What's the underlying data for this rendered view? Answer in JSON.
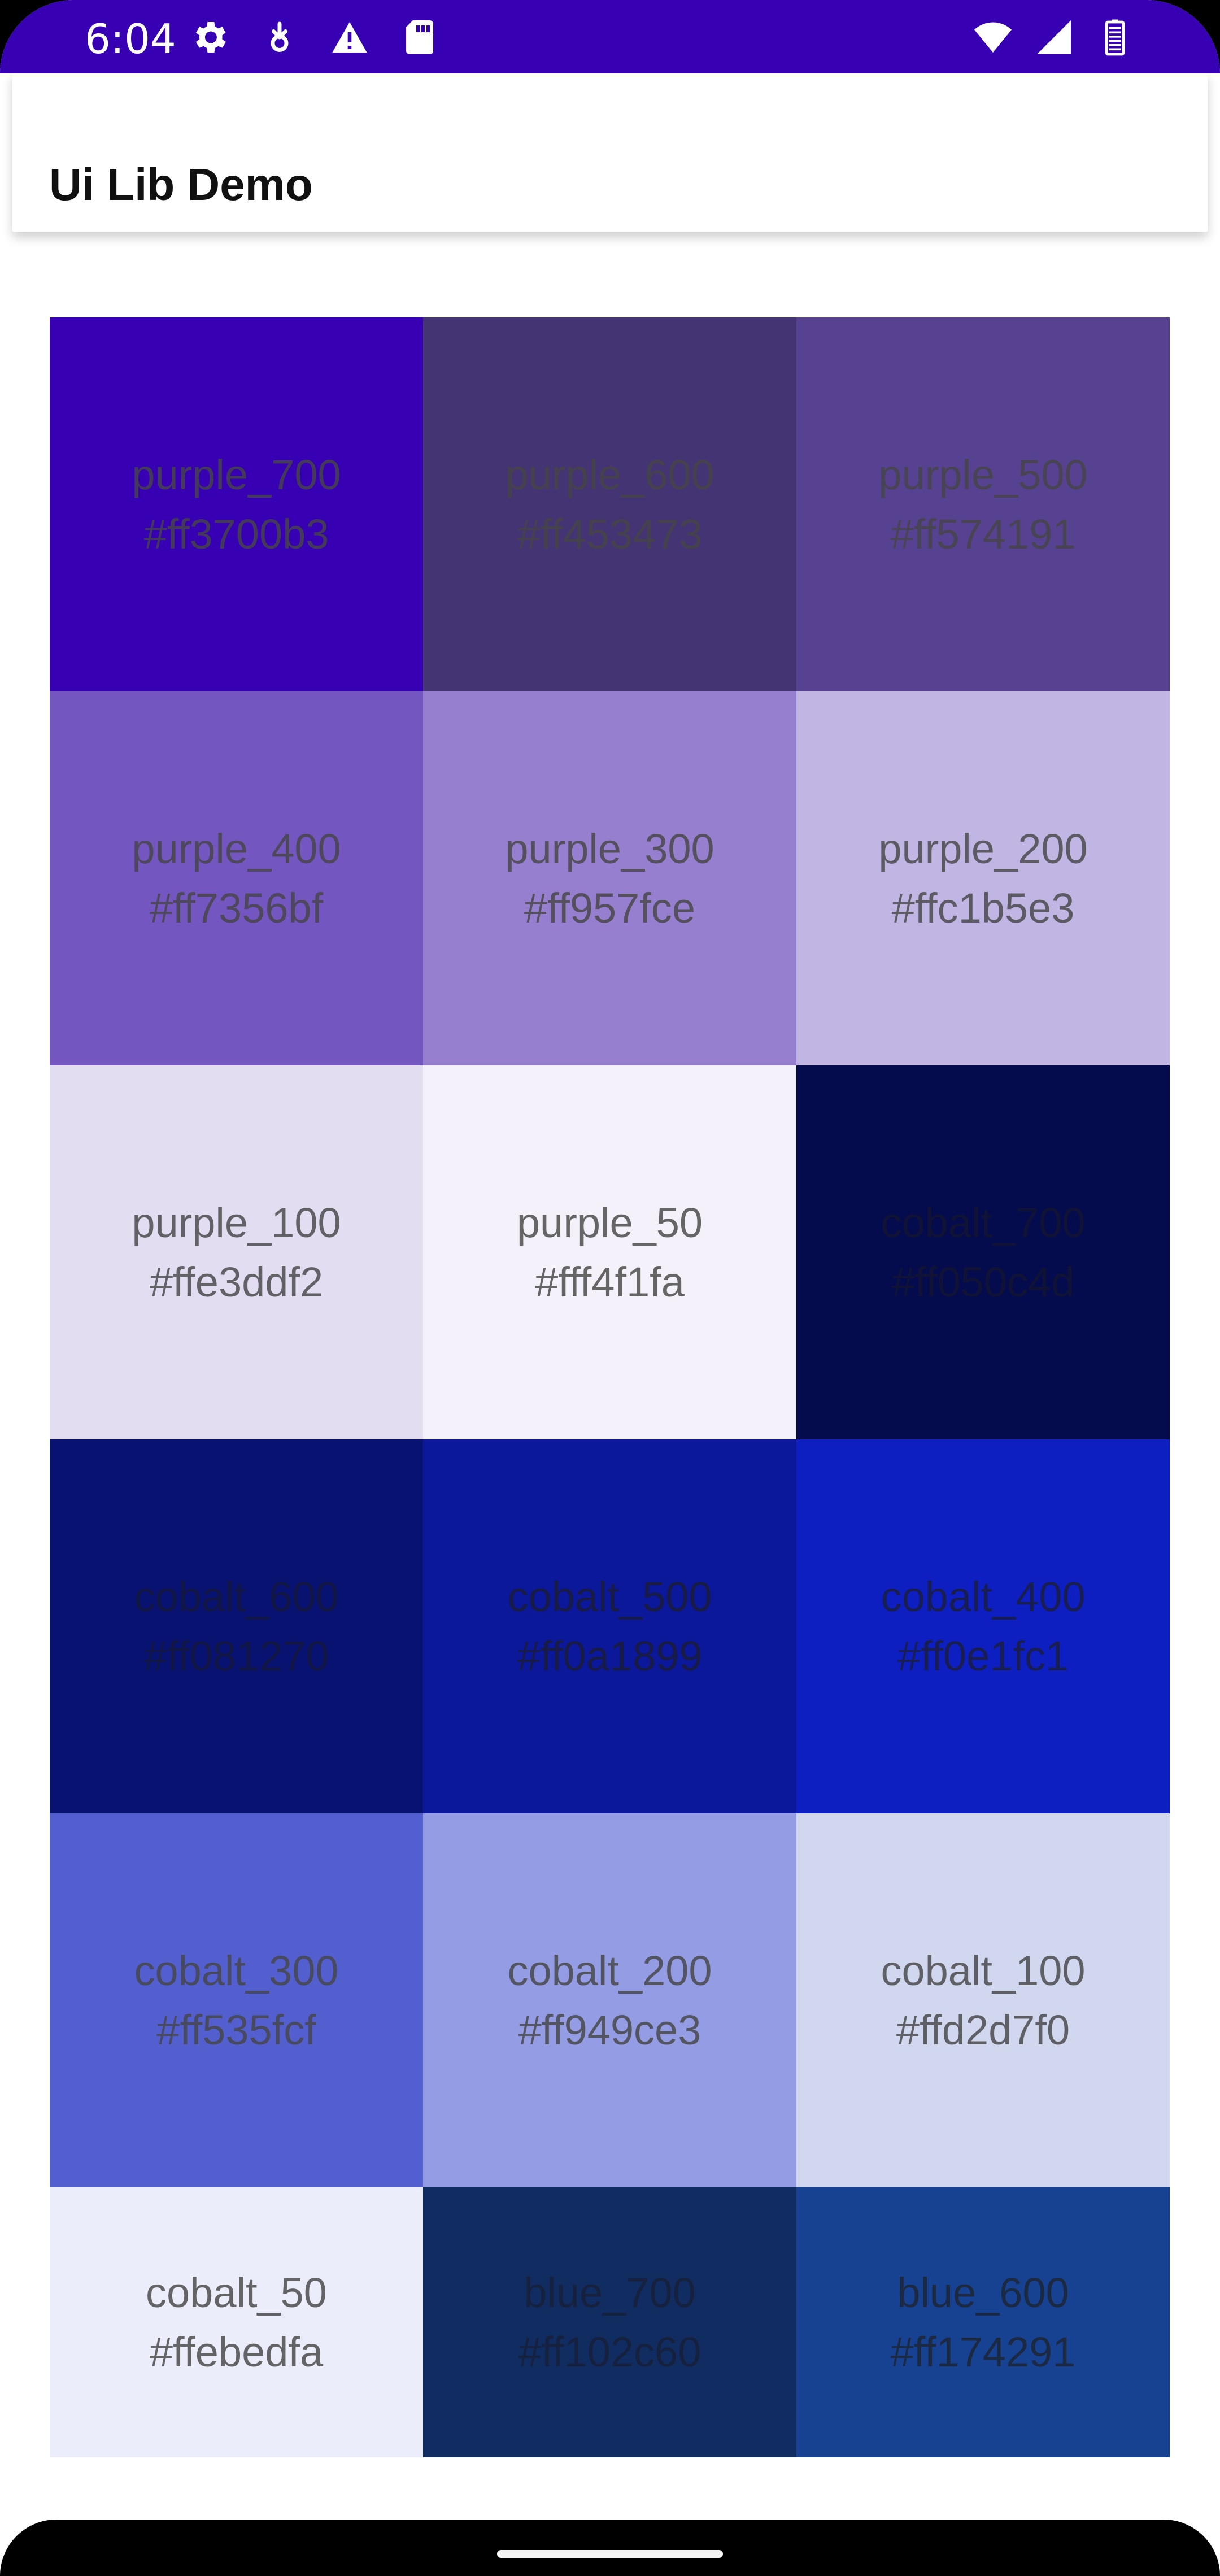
{
  "status_bar": {
    "time": "6:04",
    "left_icons": [
      "settings-icon",
      "download-icon",
      "warning-icon",
      "sd-card-icon"
    ],
    "right_icons": [
      "wifi-icon",
      "cellular-icon",
      "battery-icon"
    ]
  },
  "app_bar": {
    "title": "Ui Lib Demo"
  },
  "swatches": [
    {
      "name": "purple_700",
      "hex": "#ff3700b3",
      "color": "#3700b3"
    },
    {
      "name": "purple_600",
      "hex": "#ff453473",
      "color": "#453473"
    },
    {
      "name": "purple_500",
      "hex": "#ff574191",
      "color": "#574191"
    },
    {
      "name": "purple_400",
      "hex": "#ff7356bf",
      "color": "#7356bf"
    },
    {
      "name": "purple_300",
      "hex": "#ff957fce",
      "color": "#957fce"
    },
    {
      "name": "purple_200",
      "hex": "#ffc1b5e3",
      "color": "#c1b5e3"
    },
    {
      "name": "purple_100",
      "hex": "#ffe3ddf2",
      "color": "#e3ddf2"
    },
    {
      "name": "purple_50",
      "hex": "#fff4f1fa",
      "color": "#f4f1fa"
    },
    {
      "name": "cobalt_700",
      "hex": "#ff050c4d",
      "color": "#050c4d"
    },
    {
      "name": "cobalt_600",
      "hex": "#ff081270",
      "color": "#081270"
    },
    {
      "name": "cobalt_500",
      "hex": "#ff0a1899",
      "color": "#0a1899"
    },
    {
      "name": "cobalt_400",
      "hex": "#ff0e1fc1",
      "color": "#0e1fc1"
    },
    {
      "name": "cobalt_300",
      "hex": "#ff535fcf",
      "color": "#535fcf"
    },
    {
      "name": "cobalt_200",
      "hex": "#ff949ce3",
      "color": "#949ce3"
    },
    {
      "name": "cobalt_100",
      "hex": "#ffd2d7f0",
      "color": "#d2d7f0"
    },
    {
      "name": "cobalt_50",
      "hex": "#ffebedfa",
      "color": "#ebedfa"
    },
    {
      "name": "blue_700",
      "hex": "#ff102c60",
      "color": "#102c60"
    },
    {
      "name": "blue_600",
      "hex": "#ff174291",
      "color": "#174291"
    }
  ]
}
